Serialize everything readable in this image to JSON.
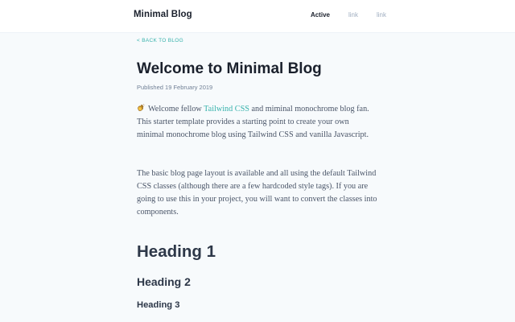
{
  "header": {
    "brand": "Minimal Blog",
    "nav": [
      {
        "label": "Active",
        "active": true
      },
      {
        "label": "link",
        "active": false
      },
      {
        "label": "link",
        "active": false
      }
    ]
  },
  "post": {
    "back_label": "< BACK TO BLOG",
    "title": "Welcome to Minimal Blog",
    "published": "Published 19 February 2019",
    "intro": {
      "before": "Welcome fellow ",
      "link_text": "Tailwind CSS",
      "after": " and miminal monochrome blog fan. This starter template provides a starting point to create your own minimal monochrome blog using Tailwind CSS and vanilla Javascript."
    },
    "paragraph_2": "The basic blog page layout is available and all using the default Tailwind CSS classes (although there are a few hardcoded style tags). If you are going to use this in your project, you will want to convert the classes into components.",
    "heading_1": "Heading 1",
    "heading_2": "Heading 2",
    "heading_3": "Heading 3"
  },
  "colors": {
    "accent": "#38b2ac",
    "text": "#2d3748",
    "muted": "#a0aec0",
    "background": "#f7fafc"
  },
  "icons": {
    "intro_icon": "waving-hand-icon"
  }
}
